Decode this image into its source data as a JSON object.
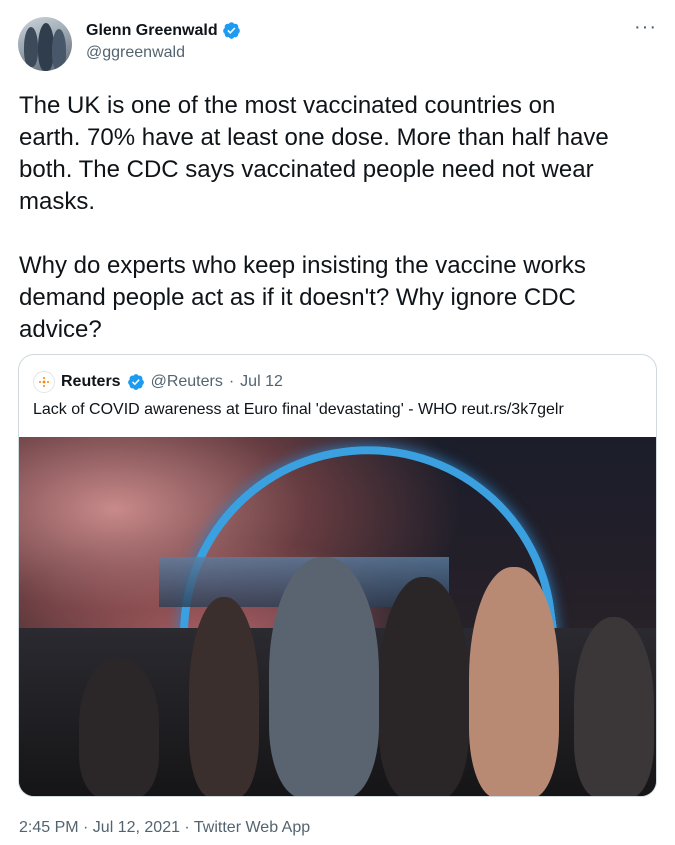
{
  "author": {
    "name": "Glenn Greenwald",
    "handle": "@ggreenwald",
    "verified_icon": "verified-badge-icon",
    "avatar_icon": "profile-avatar"
  },
  "menu_icon": "more-options-icon",
  "more_label": "···",
  "tweet": {
    "paragraph1": "The UK is one of the most vaccinated countries on\nearth. 70% have at least one dose. More than half have\nboth. The CDC says vaccinated people need not wear\nmasks.",
    "paragraph2": "Why do experts who keep insisting the vaccine works\ndemand people act as if it doesn't? Why ignore CDC\nadvice?"
  },
  "quote": {
    "name": "Reuters",
    "handle": "@Reuters",
    "separator": "·",
    "date": "Jul 12",
    "text": "Lack of COVID awareness at Euro final 'devastating' - WHO reut.rs/3k7gelr",
    "logo_label": "REUTERS",
    "image_icon": "crowd-celebration-photo"
  },
  "footer": {
    "text": "2:45 PM · Jul 12, 2021 · Twitter Web App"
  },
  "colors": {
    "text": "#0f1419",
    "secondary": "#536471",
    "border": "#cfd9de",
    "verified": "#1d9bf0"
  }
}
